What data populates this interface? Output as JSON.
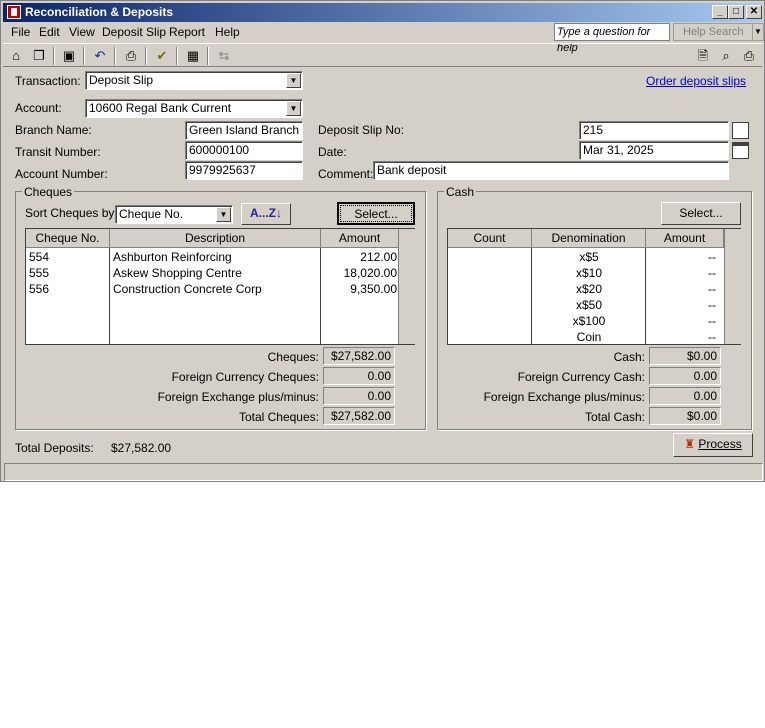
{
  "window": {
    "title": "Reconciliation & Deposits",
    "min": "_",
    "max": "□",
    "close": "✕"
  },
  "menu": [
    "File",
    "Edit",
    "View",
    "Deposit Slip",
    "Report",
    "Help"
  ],
  "help": {
    "question_placeholder": "Type a question for help",
    "search_label": "Help Search"
  },
  "toolbar_icons": [
    "home-icon",
    "windows-icon",
    "save-icon",
    "undo-icon",
    "print-slip-icon",
    "check-icon",
    "calculator-icon",
    "transfer-icon",
    "page-icon",
    "preview-icon",
    "printer-icon"
  ],
  "form": {
    "transaction_label": "Transaction:",
    "transaction_value": "Deposit Slip",
    "order_link": "Order deposit slips",
    "account_label": "Account:",
    "account_value": "10600 Regal Bank Current",
    "branch_label": "Branch Name:",
    "branch_value": "Green Island Branch",
    "transit_label": "Transit Number:",
    "transit_value": "600000100",
    "acctnum_label": "Account Number:",
    "acctnum_value": "9979925637",
    "slipno_label": "Deposit Slip No:",
    "slipno_value": "215",
    "date_label": "Date:",
    "date_value": "Mar 31, 2025",
    "comment_label": "Comment:",
    "comment_value": "Bank deposit"
  },
  "cheques": {
    "group_title": "Cheques",
    "sort_label": "Sort Cheques by:",
    "sort_value": "Cheque No.",
    "az_label": "A...Z",
    "select_label": "Select...",
    "columns": [
      "Cheque No.",
      "Description",
      "Amount"
    ],
    "rows": [
      {
        "no": "554",
        "desc": "Ashburton Reinforcing",
        "amount": "212.00"
      },
      {
        "no": "555",
        "desc": "Askew Shopping Centre",
        "amount": "18,020.00"
      },
      {
        "no": "556",
        "desc": "Construction Concrete Corp",
        "amount": "9,350.00"
      }
    ],
    "totals": [
      {
        "label": "Cheques:",
        "value": "$27,582.00"
      },
      {
        "label": "Foreign Currency Cheques:",
        "value": "0.00"
      },
      {
        "label": "Foreign Exchange plus/minus:",
        "value": "0.00"
      },
      {
        "label": "Total Cheques:",
        "value": "$27,582.00"
      }
    ]
  },
  "cash": {
    "group_title": "Cash",
    "select_label": "Select...",
    "columns": [
      "Count",
      "Denomination",
      "Amount"
    ],
    "rows": [
      {
        "count": "",
        "denom": "x$5",
        "amount": "--"
      },
      {
        "count": "",
        "denom": "x$10",
        "amount": "--"
      },
      {
        "count": "",
        "denom": "x$20",
        "amount": "--"
      },
      {
        "count": "",
        "denom": "x$50",
        "amount": "--"
      },
      {
        "count": "",
        "denom": "x$100",
        "amount": "--"
      },
      {
        "count": "",
        "denom": "Coin",
        "amount": "--"
      }
    ],
    "totals": [
      {
        "label": "Cash:",
        "value": "$0.00"
      },
      {
        "label": "Foreign Currency Cash:",
        "value": "0.00"
      },
      {
        "label": "Foreign Exchange plus/minus:",
        "value": "0.00"
      },
      {
        "label": "Total Cash:",
        "value": "$0.00"
      }
    ]
  },
  "footer": {
    "total_label": "Total Deposits:",
    "total_value": "$27,582.00",
    "process_label": "Process"
  }
}
